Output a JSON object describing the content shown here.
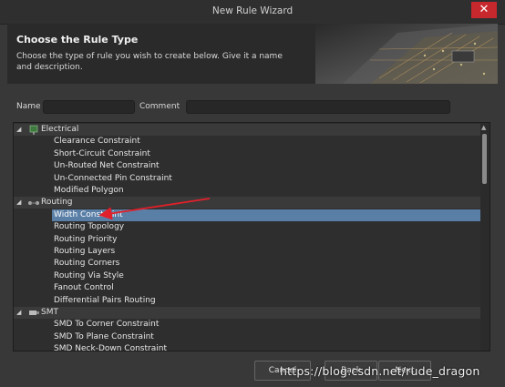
{
  "window": {
    "title": "New Rule Wizard",
    "close_label": "✕"
  },
  "header": {
    "heading": "Choose the Rule Type",
    "description": "Choose the type of rule you wish to create below. Give it a name and description."
  },
  "form": {
    "name_label": "Name",
    "name_value": "",
    "comment_label": "Comment",
    "comment_value": ""
  },
  "tree": {
    "categories": [
      {
        "label": "Electrical",
        "expanded": true,
        "icon": "electrical-icon",
        "items": [
          "Clearance Constraint",
          "Short-Circuit Constraint",
          "Un-Routed Net Constraint",
          "Un-Connected Pin Constraint",
          "Modified Polygon"
        ]
      },
      {
        "label": "Routing",
        "expanded": true,
        "icon": "routing-icon",
        "items": [
          "Width Constraint",
          "Routing Topology",
          "Routing Priority",
          "Routing Layers",
          "Routing Corners",
          "Routing Via Style",
          "Fanout Control",
          "Differential Pairs Routing"
        ]
      },
      {
        "label": "SMT",
        "expanded": true,
        "icon": "smt-icon",
        "items": [
          "SMD To Corner Constraint",
          "SMD To Plane Constraint",
          "SMD Neck-Down Constraint"
        ]
      }
    ],
    "selected_item": "Width Constraint"
  },
  "buttons": {
    "cancel": "Cancel",
    "back": "Back",
    "next": "Next"
  },
  "watermark": "https://blog.csdn.net/rude_dragon",
  "colors": {
    "selection": "#5a7fa7",
    "close": "#c7282e",
    "arrow": "#e0202a"
  }
}
